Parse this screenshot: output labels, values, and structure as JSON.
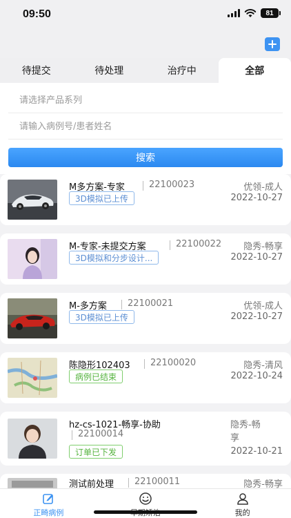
{
  "status_bar": {
    "time": "09:50",
    "battery": "81"
  },
  "nav": {
    "add_icon": "plus-icon"
  },
  "tabs": [
    {
      "label": "待提交",
      "active": false
    },
    {
      "label": "待处理",
      "active": false
    },
    {
      "label": "治疗中",
      "active": false
    },
    {
      "label": "全部",
      "active": true
    }
  ],
  "filters": {
    "product_placeholder": "请选择产品系列",
    "keyword_placeholder": "请输入病例号/患者姓名",
    "search_label": "搜索"
  },
  "cases": [
    {
      "name": "M多方案-专家",
      "case_no": "22100023",
      "product": "优领-成人",
      "date": "2022-10-27",
      "status": "3D模拟已上传",
      "status_color": "#5d8fd3",
      "thumb": "car-silver-image"
    },
    {
      "name": "M-专家-未提交方案",
      "case_no": "22100022",
      "product": "隐秀-畅享",
      "date": "2022-10-27",
      "status": "3D模拟和分步设计...",
      "status_color": "#5d8fd3",
      "thumb": "girl-portrait-image"
    },
    {
      "name": "M-多方案",
      "case_no": "22100021",
      "product": "优领-成人",
      "date": "2022-10-27",
      "status": "3D模拟已上传",
      "status_color": "#5d8fd3",
      "thumb": "car-red-image"
    },
    {
      "name": "陈隐形102403",
      "case_no": "22100020",
      "product": "隐秀-清风",
      "date": "2022-10-24",
      "status": "病例已结束",
      "status_color": "#55b33e",
      "thumb": "map-image"
    },
    {
      "name": "hz-cs-1021-畅享-协助",
      "case_no": "22100014",
      "product_line1": "隐秀-畅",
      "product_line2": "享",
      "date": "2022-10-21",
      "status": "订单已下发",
      "status_color": "#55b33e",
      "thumb": "child-portrait-image"
    },
    {
      "name": "测试前处理",
      "case_no": "22100011",
      "product": "隐秀-畅享",
      "thumb": "blurred-image"
    }
  ],
  "tab_bar": [
    {
      "label": "正畸病例",
      "icon": "edit-icon",
      "active": true
    },
    {
      "label": "早期矫治",
      "icon": "smile-icon",
      "active": false
    },
    {
      "label": "我的",
      "icon": "person-icon",
      "active": false
    }
  ],
  "colors": {
    "accent": "#3d93f2",
    "badge_blue": "#5d8fd3",
    "badge_green": "#55b33e"
  }
}
